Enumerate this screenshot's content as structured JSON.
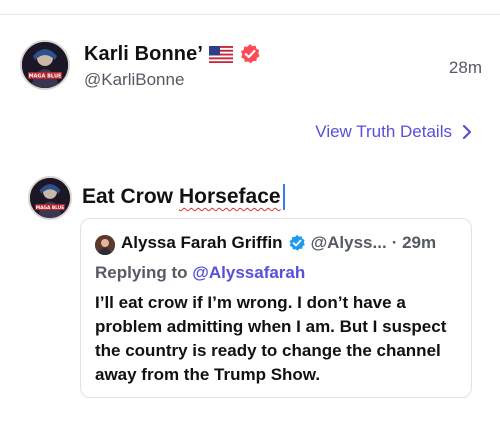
{
  "post": {
    "display_name": "Karli Bonne’",
    "handle": "@KarliBonne",
    "time": "28m",
    "avatar_text": "MAGA BLUE"
  },
  "details_link": {
    "label": "View Truth Details"
  },
  "reply": {
    "word1": "Eat Crow",
    "word2": "Horseface"
  },
  "quote": {
    "name": "Alyssa Farah Griffin",
    "handle": "@Alyss...",
    "time": "· 29m",
    "replying_prefix": "Replying to",
    "replying_to": "@Alyssafarah",
    "body": "I’ll eat crow if I’m wrong. I don’t have a problem admitting when I am. But I suspect the country is ready to change the channel away from the Trump Show."
  },
  "colors": {
    "accent": "#5a4fd9",
    "verified_badge": "#ff4a57",
    "quote_verified": "#1d9bf0",
    "muted_text": "#555a63"
  },
  "icons": {
    "flag": "us-flag-icon",
    "verified": "verified-badge-icon",
    "chevron": "chevron-right-icon"
  }
}
